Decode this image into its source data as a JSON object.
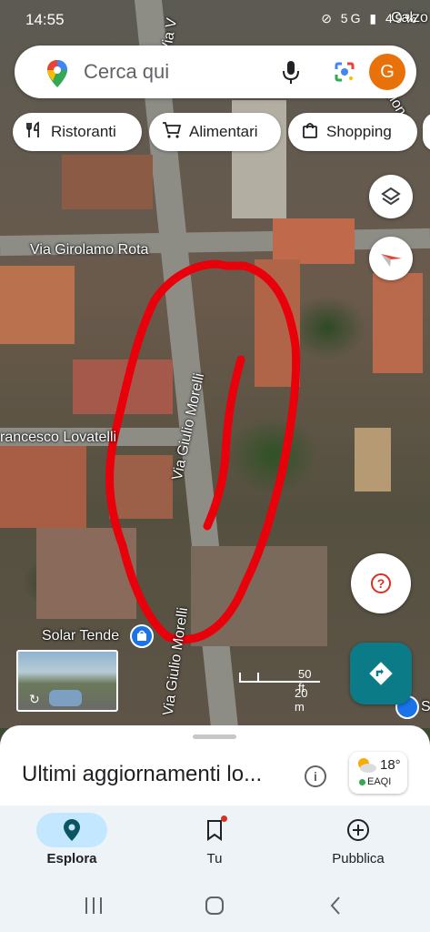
{
  "status_bar": {
    "time": "14:55",
    "icons": "⊘ 5G ▮ 49%"
  },
  "search": {
    "placeholder": "Cerca qui",
    "avatar_letter": "G"
  },
  "chips": [
    {
      "label": "Ristoranti",
      "icon": "fork-knife-icon"
    },
    {
      "label": "Alimentari",
      "icon": "cart-icon"
    },
    {
      "label": "Shopping",
      "icon": "bag-icon"
    }
  ],
  "map": {
    "labels": {
      "calzo": "Calzo",
      "zione": "zione",
      "via_girolamo_rota": "Via Girolamo Rota",
      "via_giulio_morelli_1": "Via Giulio Morelli",
      "via_giulio_morelli_2": "Via Giulio Morelli",
      "francesco_lovatelli": "rancesco Lovatelli",
      "solar_tende": "Solar Tende",
      "via_v": "Via V",
      "s_label": "S"
    },
    "scale": {
      "ft": "50 ft",
      "m": "20 m"
    },
    "annotation_color": "#e8000b"
  },
  "sheet": {
    "title": "Ultimi aggiornamenti lo...",
    "info_icon": "i",
    "weather": {
      "temp": "18°",
      "aqi": "EAQI"
    }
  },
  "bottom_nav": [
    {
      "label": "Esplora",
      "icon": "pin-icon",
      "active": true
    },
    {
      "label": "Tu",
      "icon": "bookmark-icon",
      "active": false
    },
    {
      "label": "Pubblica",
      "icon": "add-circle-icon",
      "active": false
    }
  ],
  "system_nav": [
    "recents",
    "home",
    "back"
  ],
  "colors": {
    "accent_teal": "#0b7c87",
    "active_pill": "#c2e7ff",
    "avatar": "#e8710a"
  }
}
